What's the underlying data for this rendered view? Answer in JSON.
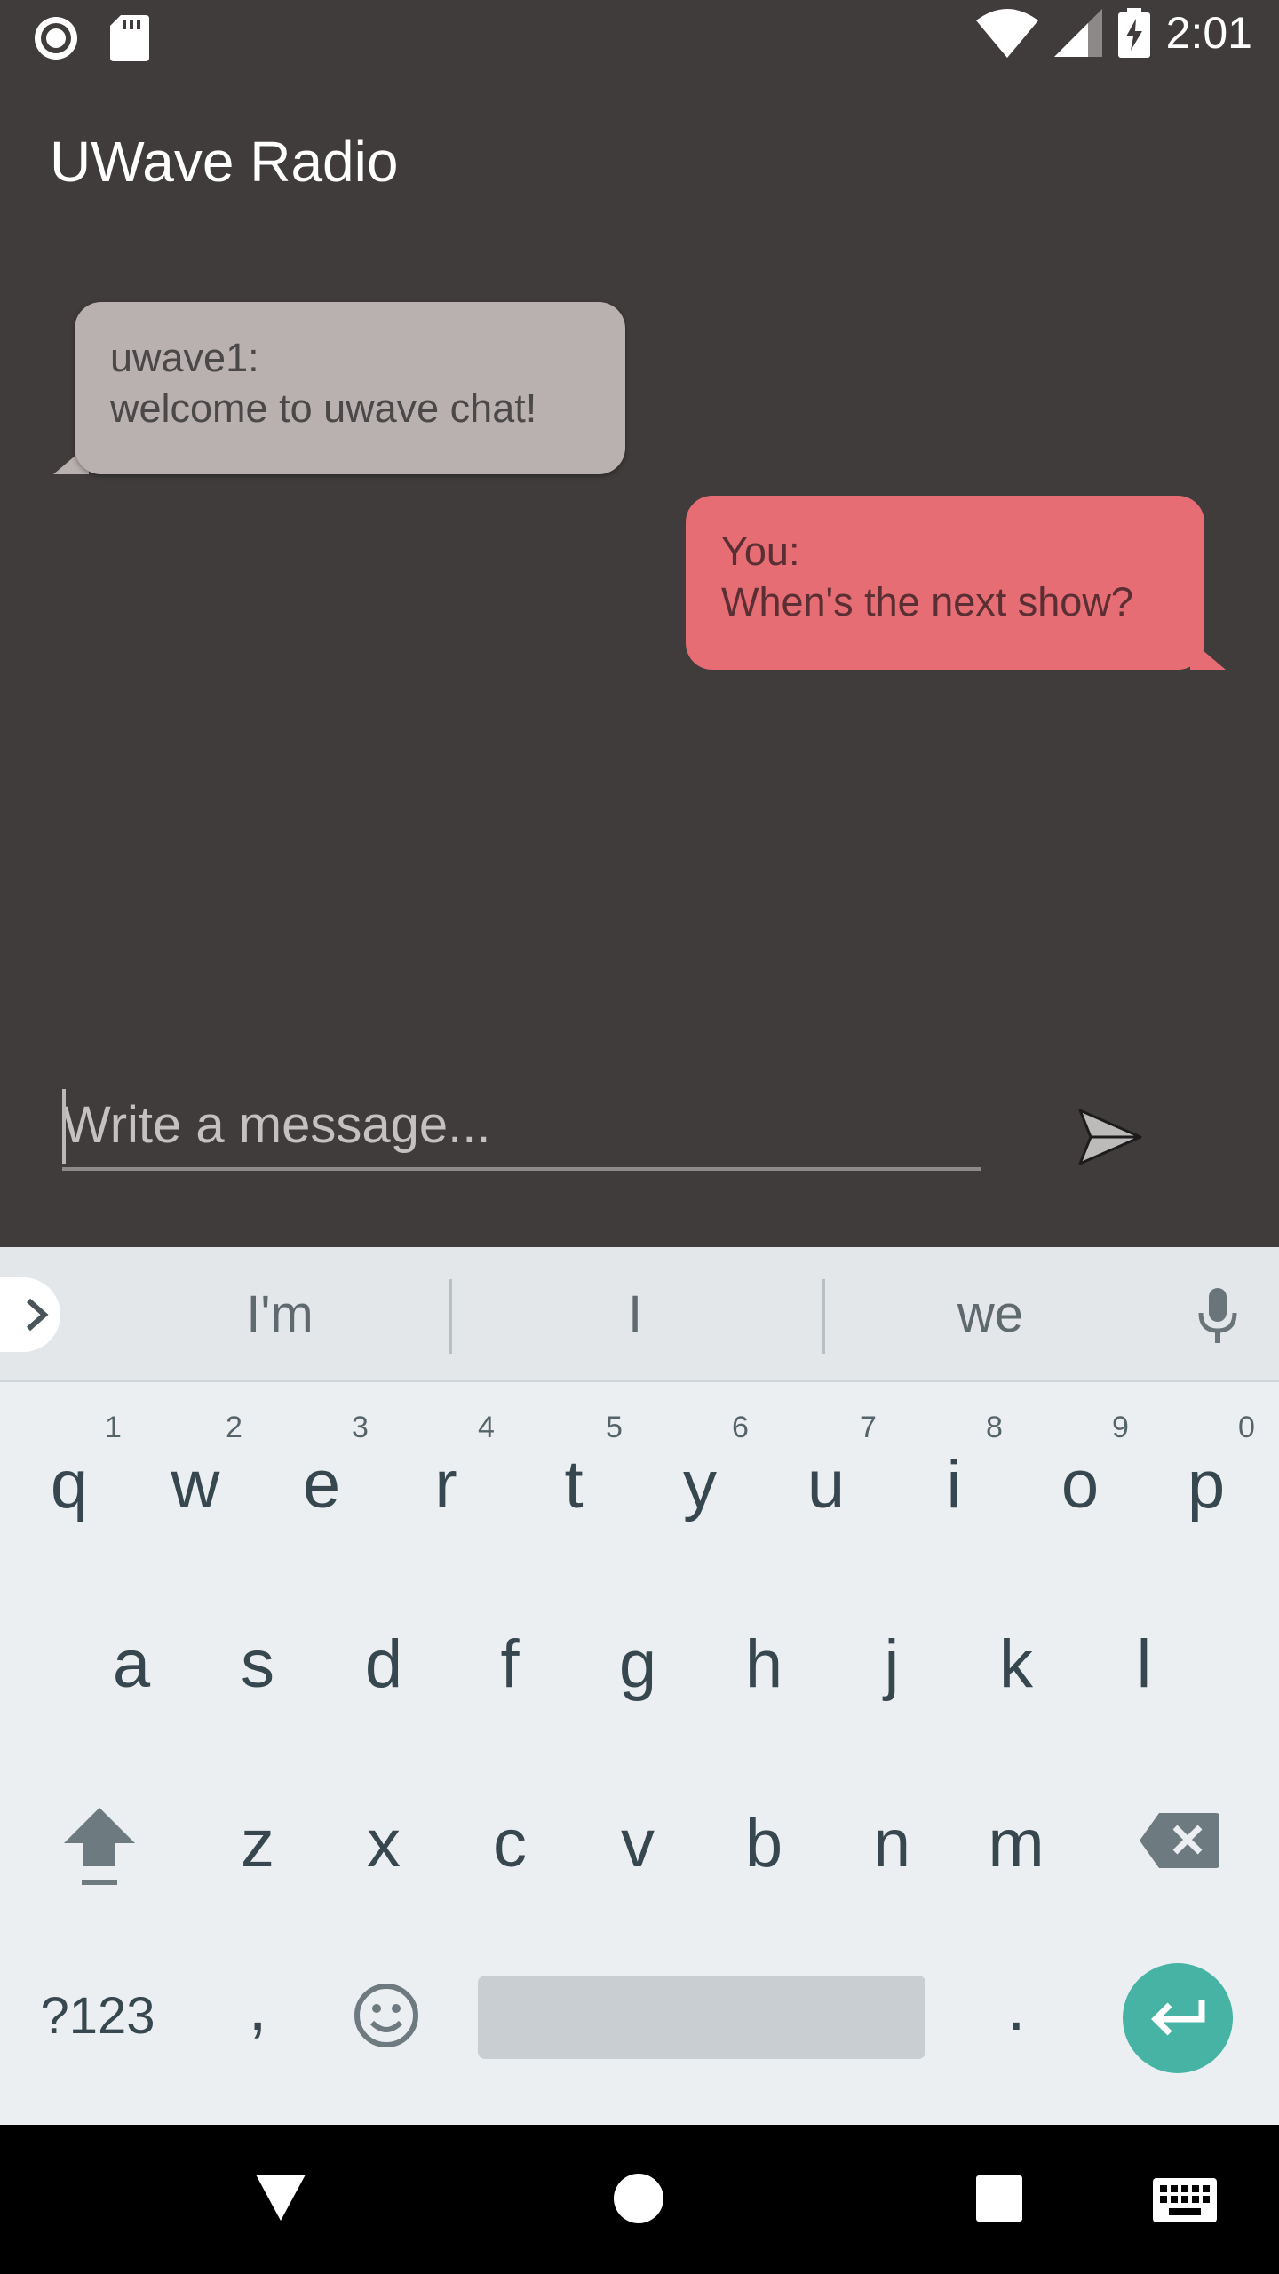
{
  "status_bar": {
    "time": "2:01",
    "left_icons": [
      "record-icon",
      "sd-card-icon"
    ],
    "right_icons": [
      "wifi-icon",
      "cell-signal-icon",
      "battery-charging-icon"
    ]
  },
  "app": {
    "title": "UWave Radio"
  },
  "messages": [
    {
      "sender": "uwave1:",
      "text": "welcome to uwave chat!",
      "direction": "incoming"
    },
    {
      "sender": "You:",
      "text": "When's the next show?",
      "direction": "outgoing"
    }
  ],
  "composer": {
    "placeholder": "Write a message...",
    "send_icon": "send-icon"
  },
  "keyboard": {
    "suggestions": [
      "I'm",
      "I",
      "we"
    ],
    "row1": [
      "q",
      "w",
      "e",
      "r",
      "t",
      "y",
      "u",
      "i",
      "o",
      "p"
    ],
    "row1_hints": [
      "1",
      "2",
      "3",
      "4",
      "5",
      "6",
      "7",
      "8",
      "9",
      "0"
    ],
    "row2": [
      "a",
      "s",
      "d",
      "f",
      "g",
      "h",
      "j",
      "k",
      "l"
    ],
    "row3": [
      "z",
      "x",
      "c",
      "v",
      "b",
      "n",
      "m"
    ],
    "symbols_label": "?123",
    "comma_label": ",",
    "period_label": "."
  },
  "colors": {
    "background": "#403c3c",
    "incoming_bubble": "#b9b0b0",
    "outgoing_bubble": "#e56d73",
    "enter_key": "#46b3a5"
  }
}
